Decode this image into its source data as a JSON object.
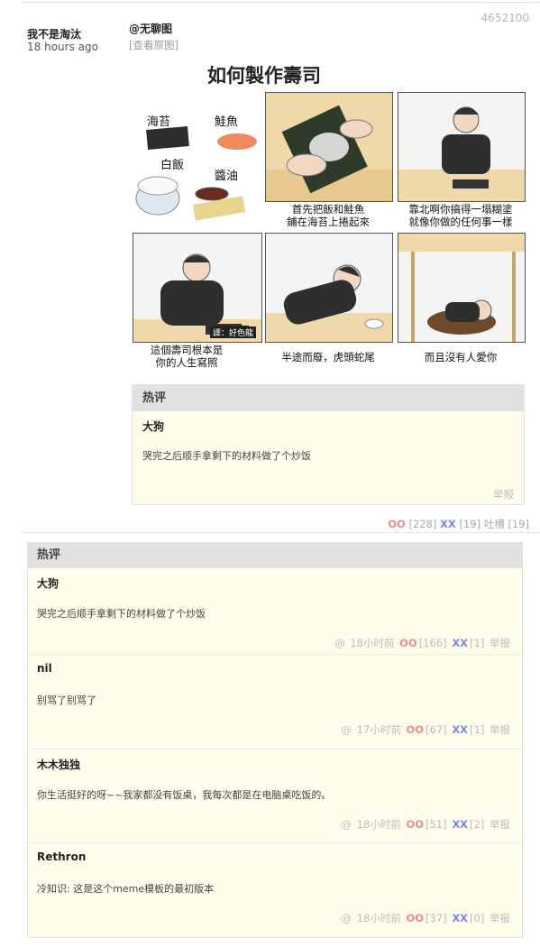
{
  "post": {
    "id": "4652100",
    "author": "我不是淘汰",
    "time": "18 hours ago",
    "mention": "@无聊图",
    "view_original": "[查看原图]"
  },
  "comic": {
    "title": "如何製作壽司",
    "ingredients": [
      "海苔",
      "鮭魚",
      "白飯",
      "醬油"
    ],
    "captions": [
      "首先把飯和鮭魚\n鋪在海苔上捲起來",
      "靠北啊你搞得一塌糊塗\n就像你做的任何事一樣",
      "這個壽司根本是\n你的人生寫照",
      "半途而廢，虎頭蛇尾",
      "而且沒有人愛你"
    ],
    "credit": "譯：好色龍"
  },
  "hot_preview": {
    "header": "热评",
    "name": "大狗",
    "text": "哭完之后顺手拿剩下的材料做了个炒饭",
    "report": "举报"
  },
  "post_stats": {
    "oo_label": "OO",
    "oo_count": "[228]",
    "xx_label": "XX",
    "xx_count": "[19]",
    "tucao_label": "吐槽",
    "tucao_count": "[19]"
  },
  "comments_box": {
    "header": "热评",
    "items": [
      {
        "name": "大狗",
        "text": "哭完之后顺手拿剩下的材料做了个炒饭",
        "at": "@",
        "time": "18小时前",
        "oo": "OO",
        "oo_count": "[166]",
        "xx": "XX",
        "xx_count": "[1]",
        "report": "举报"
      },
      {
        "name": "nil",
        "text": "别骂了别骂了",
        "at": "@",
        "time": "17小时前",
        "oo": "OO",
        "oo_count": "[67]",
        "xx": "XX",
        "xx_count": "[1]",
        "report": "举报"
      },
      {
        "name": "木木独独",
        "text": "你生活挺好的呀~~我家都没有饭桌，我每次都是在电脑桌吃饭的。",
        "at": "@",
        "time": "18小时前",
        "oo": "OO",
        "oo_count": "[51]",
        "xx": "XX",
        "xx_count": "[2]",
        "report": "举报"
      },
      {
        "name": "Rethron",
        "text": "冷知识: 这是这个meme模板的最初版本",
        "at": "@",
        "time": "18小时前",
        "oo": "OO",
        "oo_count": "[37]",
        "xx": "XX",
        "xx_count": "[0]",
        "report": "举报"
      }
    ]
  },
  "colors": {
    "oo": "#f08a8a",
    "xx": "#7788ee",
    "comment_bg": "#fffeed",
    "header_bg": "#e2e2e2"
  }
}
